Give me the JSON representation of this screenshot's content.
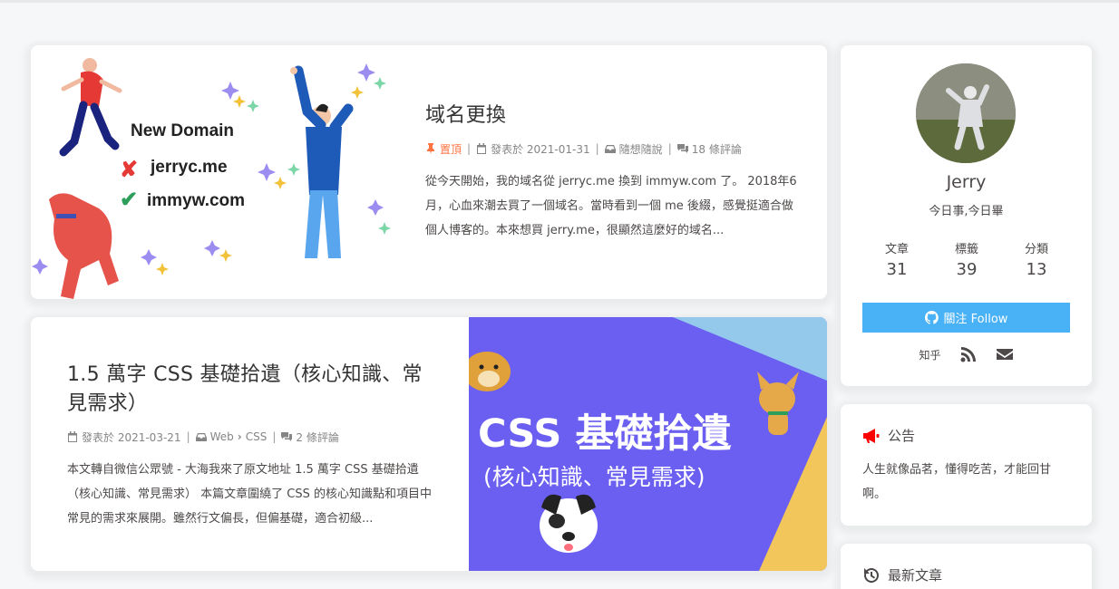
{
  "posts": [
    {
      "title": "域名更換",
      "pinned_label": "置頂",
      "date": "發表於 2021-01-31",
      "category": "隨想隨說",
      "comments": "18 條評論",
      "excerpt": "從今天開始，我的域名從 jerryc.me 換到 immyw.com 了。 2018年6月，心血來潮去買了一個域名。當時看到一個 me 後綴，感覺挺適合做個人博客的。本來想買 jerry.me，很顯然這麼好的域名...",
      "cover": {
        "heading": "New Domain",
        "old_domain": "jerryc.me",
        "new_domain": "immyw.com"
      }
    },
    {
      "title": "1.5 萬字 CSS 基礎拾遺（核心知識、常見需求）",
      "date": "發表於 2021-03-21",
      "category": "Web",
      "subcategory": "CSS",
      "comments": "2 條評論",
      "excerpt": "本文轉自微信公眾號 - 大海我來了原文地址 1.5 萬字 CSS 基礎拾遺（核心知識、常見需求） 本篇文章圍繞了 CSS 的核心知識點和項目中常見的需求來展開。雖然行文偏長，但偏基礎，適合初級...",
      "cover": {
        "line1": "CSS 基礎拾遺",
        "line2": "(核心知識、常見需求)",
        "bg_color": "#6a5ff0",
        "accent_color": "#f2c65a"
      }
    }
  ],
  "author": {
    "name": "Jerry",
    "description": "今日事,今日畢",
    "stats": [
      {
        "label": "文章",
        "value": "31"
      },
      {
        "label": "標籤",
        "value": "39"
      },
      {
        "label": "分類",
        "value": "13"
      }
    ],
    "follow_label": "關注 Follow",
    "follow_color": "#49b1f5",
    "social_zhihu": "知乎"
  },
  "notice": {
    "title": "公告",
    "text": "人生就像品茗，懂得吃苦，才能回甘啊。"
  },
  "recent": {
    "title": "最新文章"
  }
}
